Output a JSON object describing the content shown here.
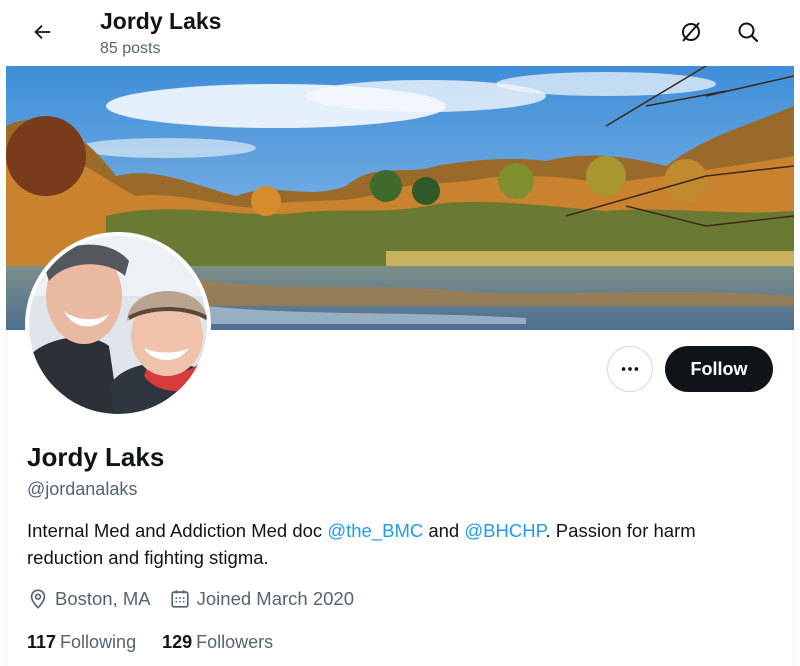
{
  "header": {
    "name": "Jordy Laks",
    "posts": "85 posts",
    "back_icon": "arrow-left-icon",
    "actions": [
      "unfollow-list-icon",
      "search-icon"
    ]
  },
  "profile": {
    "display_name": "Jordy Laks",
    "handle": "@jordanalaks",
    "bio_before": "Internal Med and Addiction Med doc ",
    "bio_mention_1": "@the_BMC",
    "bio_between": " and ",
    "bio_mention_2": "@BHCHP",
    "bio_after": ". Passion for harm reduction and fighting stigma.",
    "location": "Boston, MA",
    "joined": "Joined March 2020",
    "following_count": "117",
    "following_label": "Following",
    "followers_count": "129",
    "followers_label": "Followers"
  },
  "actions": {
    "more_label": "•••",
    "follow_label": "Follow"
  },
  "colors": {
    "link": "#1d9bf0",
    "secondary_text": "#536471",
    "follow_bg": "#0f1419"
  }
}
